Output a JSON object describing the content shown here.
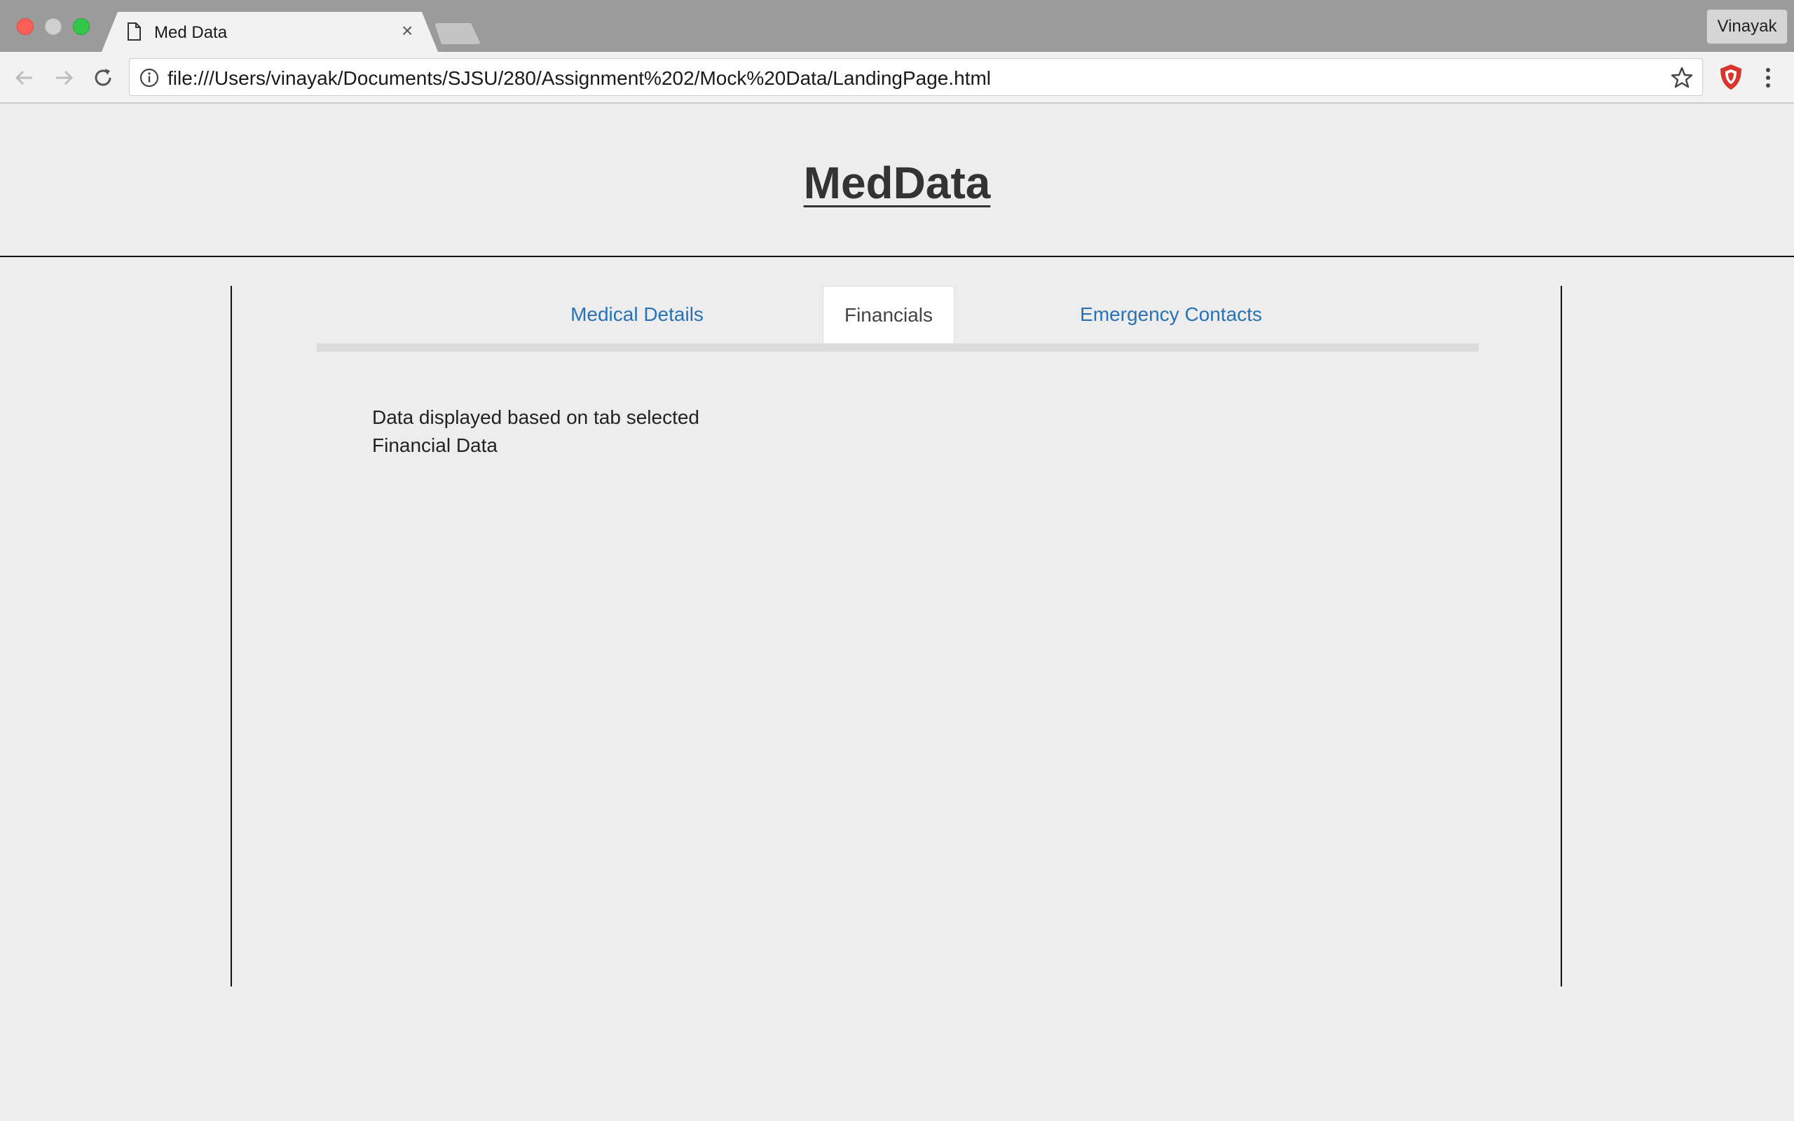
{
  "browser": {
    "tab_title": "Med Data",
    "tab_close": "×",
    "profile_name": "Vinayak",
    "url": "file:///Users/vinayak/Documents/SJSU/280/Assignment%202/Mock%20Data/LandingPage.html"
  },
  "page": {
    "title": "MedData",
    "tabs": [
      {
        "label": "Medical Details",
        "active": false
      },
      {
        "label": "Financials",
        "active": true
      },
      {
        "label": "Emergency Contacts",
        "active": false
      }
    ],
    "content": {
      "line1": "Data displayed based on tab selected",
      "line2": "Financial Data"
    }
  },
  "icons": {
    "back": "arrow-left-icon",
    "forward": "arrow-right-icon",
    "reload": "reload-icon",
    "info": "info-icon",
    "star": "star-icon",
    "extension": "shield-extension-icon",
    "menu": "kebab-menu-icon"
  },
  "colors": {
    "link": "#2a72b5",
    "page_bg": "#ededed",
    "title": "#333333"
  }
}
